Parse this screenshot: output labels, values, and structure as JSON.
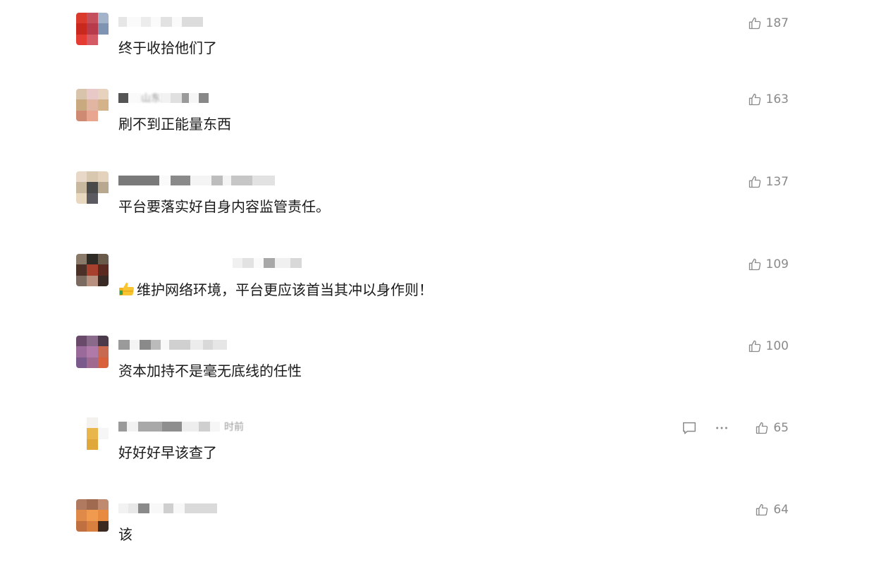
{
  "comments": [
    {
      "username": "",
      "text": "终于收拾他们了",
      "likes": "187",
      "time": ""
    },
    {
      "username": "山东",
      "text": "刷不到正能量东西",
      "likes": "163",
      "time": ""
    },
    {
      "username": "",
      "text": "平台要落实好自身内容监管责任。",
      "likes": "137",
      "time": ""
    },
    {
      "username": "",
      "text": "维护网络环境，平台更应该首当其冲以身作则！",
      "likes": "109",
      "time": ""
    },
    {
      "username": "",
      "text": "资本加持不是毫无底线的任性",
      "likes": "100",
      "time": ""
    },
    {
      "username": "",
      "text": "好好好早该查了",
      "likes": "65",
      "time": "时前"
    },
    {
      "username": "",
      "text": "该",
      "likes": "64",
      "time": ""
    }
  ],
  "icons": {
    "like": "thumbs-up-icon",
    "reply": "comment-bubble-icon",
    "more": "ellipsis-icon",
    "emoji": "thumbs-up-emoji"
  },
  "colors": {
    "text": "#1a1a1a",
    "meta": "#8a8a8a"
  }
}
